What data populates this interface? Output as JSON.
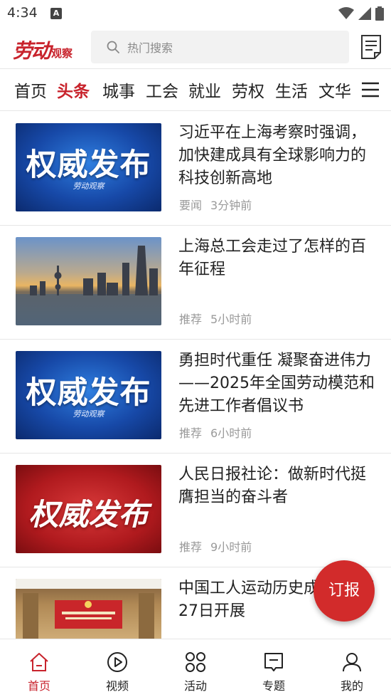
{
  "status_bar": {
    "time": "4:34"
  },
  "header": {
    "logo_main": "劳动",
    "logo_sub": "观察",
    "search_placeholder": "热门搜索"
  },
  "tabs": [
    "首页",
    "头条",
    "城事",
    "工会",
    "就业",
    "劳权",
    "生活",
    "文华"
  ],
  "active_tab": "头条",
  "news": [
    {
      "title": "习近平在上海考察时强调，加快建成具有全球影响力的科技创新高地",
      "thumb_text": "权威发布",
      "thumb_sub": "劳动观察",
      "tag": "要闻",
      "time": "3分钟前"
    },
    {
      "title": "上海总工会走过了怎样的百年征程",
      "tag": "推荐",
      "time": "5小时前"
    },
    {
      "title": "勇担时代重任 凝聚奋进伟力——2025年全国劳动模范和先进工作者倡议书",
      "thumb_text": "权威发布",
      "thumb_sub": "劳动观察",
      "tag": "推荐",
      "time": "6小时前"
    },
    {
      "title": "人民日报社论：做新时代挺膺担当的奋斗者",
      "thumb_text": "权威发布",
      "tag": "推荐",
      "time": "9小时前"
    },
    {
      "title": "中国工人运动历史成就展4月27日开展"
    }
  ],
  "fab_label": "订报",
  "bottom_nav": [
    {
      "label": "首页",
      "icon": "home-icon"
    },
    {
      "label": "视频",
      "icon": "play-icon"
    },
    {
      "label": "活动",
      "icon": "activity-icon"
    },
    {
      "label": "专题",
      "icon": "topic-icon"
    },
    {
      "label": "我的",
      "icon": "profile-icon"
    }
  ],
  "colors": {
    "accent": "#c8232c",
    "fab": "#d22b2b"
  }
}
